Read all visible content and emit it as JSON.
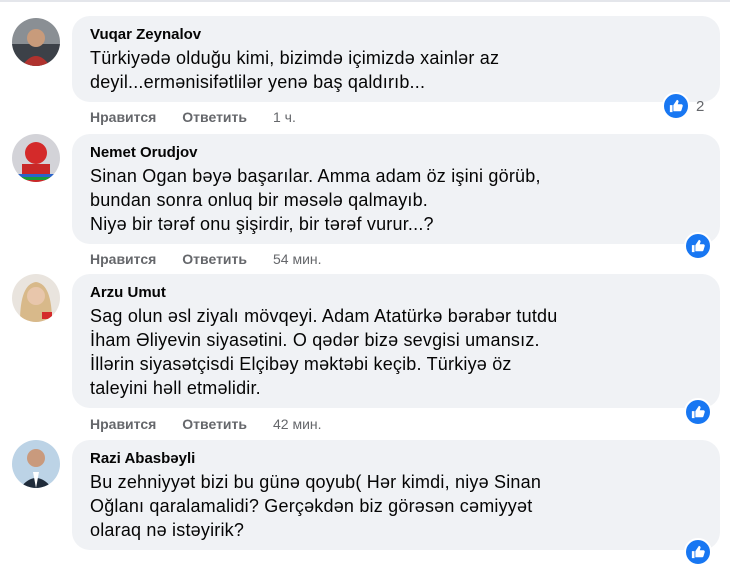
{
  "comments": [
    {
      "author": "Vuqar Zeynalov",
      "text": "Türkiyədə olduğu kimi, bizimdə içimizdə xainlər az\ndeyil...ermənisifətlilər yenə baş qaldırıb...",
      "like_label": "Нравится",
      "reply_label": "Ответить",
      "time": "1 ч.",
      "reactions": "2"
    },
    {
      "author": "Nemet Orudjov",
      "text": "Sinan Ogan bəyə başarılar. Amma adam öz işini görüb,\nbundan sonra onluq bir məsələ qalmayıb.\nNiyə bir tərəf onu şişirdir, bir tərəf vurur...?",
      "like_label": "Нравится",
      "reply_label": "Ответить",
      "time": "54 мин."
    },
    {
      "author": "Arzu Umut",
      "text": "Sag olun əsl ziyalı mövqeyi. Adam Atatürkə bərabər tutdu\nİham Əliyevin siyasətini. O qədər bizə sevgisi umansız.\nİllərin siyasətçisdi Elçibəy məktəbi keçib. Türkiyə öz\ntaleyini həll etməlidir.",
      "like_label": "Нравится",
      "reply_label": "Ответить",
      "time": "42 мин."
    },
    {
      "author": "Razi Abasbəyli",
      "text": "Bu zehniyyət bizi bu günə qoyub( Hər kimdi, niyə Sinan\nOğlanı qaralamalidi? Gerçəkdən biz görəsən cəmiyyət\nolaraq nə istəyirik?"
    }
  ],
  "colors": {
    "like_blue": "#1877f2",
    "bubble_bg": "#f0f2f5",
    "meta_gray": "#65676b"
  }
}
